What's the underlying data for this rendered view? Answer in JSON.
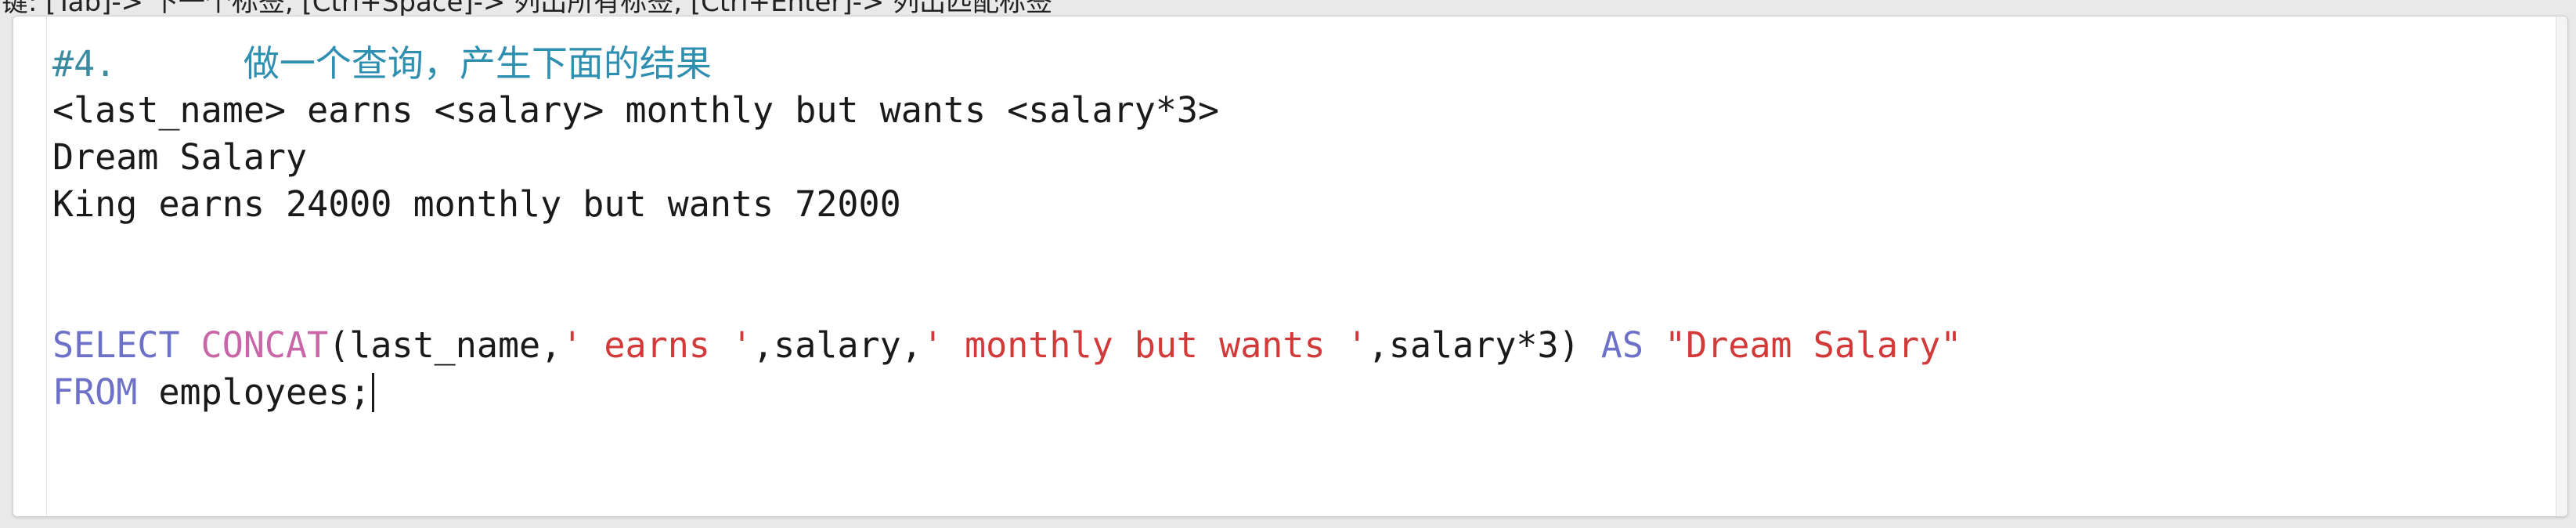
{
  "hint_bar": {
    "text": "键: [Tab]-> 下一个标签, [Ctrl+Space]-> 列出所有标签, [Ctrl+Enter]-> 列出匹配标签"
  },
  "editor": {
    "lines": [
      {
        "parts": [
          {
            "t": "#4.      ",
            "k": "num"
          },
          {
            "t": "做一个查询，产生下面的结果",
            "k": "cjk"
          }
        ]
      },
      {
        "parts": [
          {
            "t": "<last_name> earns <salary> monthly but wants <salary*3>",
            "k": "plain"
          }
        ]
      },
      {
        "parts": [
          {
            "t": "Dream Salary",
            "k": "plain"
          }
        ]
      },
      {
        "parts": [
          {
            "t": "King earns 24000 monthly but wants 72000",
            "k": "plain"
          }
        ]
      },
      {
        "parts": [
          {
            "t": "",
            "k": "plain"
          }
        ]
      },
      {
        "parts": [
          {
            "t": "",
            "k": "plain"
          }
        ]
      },
      {
        "parts": [
          {
            "t": "SELECT",
            "k": "kw"
          },
          {
            "t": " ",
            "k": "plain"
          },
          {
            "t": "CONCAT",
            "k": "fn"
          },
          {
            "t": "(last_name,",
            "k": "plain"
          },
          {
            "t": "' earns '",
            "k": "str"
          },
          {
            "t": ",salary,",
            "k": "plain"
          },
          {
            "t": "' monthly but wants '",
            "k": "str"
          },
          {
            "t": ",salary*3) ",
            "k": "plain"
          },
          {
            "t": "AS",
            "k": "kw"
          },
          {
            "t": " ",
            "k": "plain"
          },
          {
            "t": "\"Dream Salary\"",
            "k": "str"
          }
        ]
      },
      {
        "parts": [
          {
            "t": "FROM",
            "k": "kw"
          },
          {
            "t": " employees;",
            "k": "plain"
          }
        ],
        "cursor": true
      }
    ]
  },
  "colors": {
    "keyword": "#6d72c8",
    "function": "#c866a8",
    "string": "#d23a3a",
    "comment": "#2f8fb0",
    "text": "#1a1a1a"
  }
}
